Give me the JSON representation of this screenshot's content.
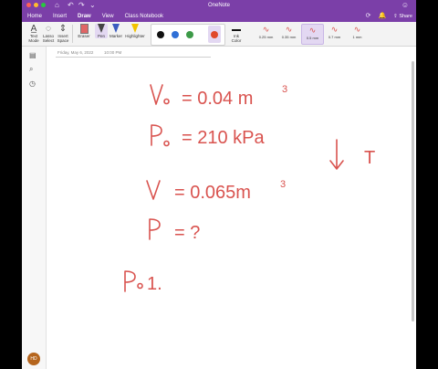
{
  "app": {
    "title": "OneNote",
    "traffic_light_colors": [
      "#ff5f57",
      "#febc2e",
      "#28c840"
    ]
  },
  "tabs": [
    {
      "label": "Home"
    },
    {
      "label": "Insert"
    },
    {
      "label": "Draw"
    },
    {
      "label": "View"
    },
    {
      "label": "Class Notebook"
    }
  ],
  "share_label": "Share",
  "tools": [
    {
      "label1": "Text",
      "label2": "Mode"
    },
    {
      "label1": "Lasso",
      "label2": "Select"
    },
    {
      "label1": "Insert",
      "label2": "Space"
    },
    {
      "label1": "Eraser",
      "label2": ""
    },
    {
      "label1": "Pen",
      "label2": ""
    },
    {
      "label1": "Marker",
      "label2": ""
    },
    {
      "label1": "Highlighter",
      "label2": ""
    }
  ],
  "pen_colors": [
    "#111111",
    "#2f6fd6",
    "#3d9a48",
    "#e0492b"
  ],
  "ink_color": {
    "label1": "Ink",
    "label2": "Color"
  },
  "thicknesses": [
    {
      "label": "0.25 mm"
    },
    {
      "label": "0.35 mm"
    },
    {
      "label": "0.5 mm"
    },
    {
      "label": "0.7 mm"
    },
    {
      "label": "1 mm"
    }
  ],
  "selected_thickness_index": 2,
  "note": {
    "date": "Friday, May 6, 2022",
    "time": "10:00 PM"
  },
  "user": {
    "initials": "HD"
  },
  "ink_text": {
    "v0_val": "= 0.04 m",
    "v0_exp": "3",
    "p0_val": "= 210 kPa",
    "v_val": "= 0.065m",
    "v_exp": "3",
    "p_val": "= ?",
    "p0_ratio": "1.",
    "temp": "T"
  },
  "ink_stroke_color": "#d9534f"
}
